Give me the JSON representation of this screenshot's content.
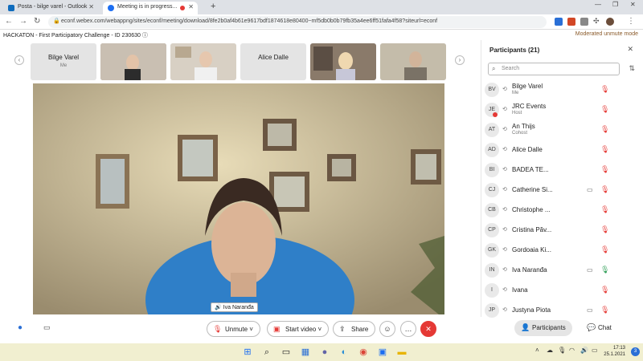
{
  "browser": {
    "tabs": [
      {
        "title": "Posta - bilge varel - Outlook",
        "active": false
      },
      {
        "title": "Meeting is in progress...",
        "active": true
      }
    ],
    "url": "econf.webex.com/webappng/sites/econf/meeting/download/8fe2b0af4b61e9617bdf1874618e80400~mf5db0b0b79fb35a4ee6ff51fafa4f58?siteurl=econf"
  },
  "meeting": {
    "title": "HACKATON - First Participatory Challenge - ID 230630",
    "moderated_unmute": "Moderated unmute mode"
  },
  "thumbnails": [
    {
      "name": "Bilge Varel",
      "sub": "Me",
      "type": "name"
    },
    {
      "name": "",
      "sub": "",
      "type": "video"
    },
    {
      "name": "",
      "sub": "",
      "type": "video"
    },
    {
      "name": "Alice Dalle",
      "sub": "",
      "type": "name"
    },
    {
      "name": "",
      "sub": "",
      "type": "video"
    },
    {
      "name": "",
      "sub": "",
      "type": "video"
    }
  ],
  "active_speaker": {
    "label": "Iva Naranđa"
  },
  "controls": {
    "unmute": "Unmute",
    "start_video": "Start video",
    "share": "Share"
  },
  "participants_panel": {
    "title": "Participants (21)",
    "search_placeholder": "Search",
    "rows": [
      {
        "initials": "BV",
        "name": "Bilge Varel",
        "role": "Me",
        "cam": false,
        "mic": "muted",
        "rec": false
      },
      {
        "initials": "JE",
        "name": "JRC Events",
        "role": "Host",
        "cam": false,
        "mic": "muted",
        "rec": true
      },
      {
        "initials": "AT",
        "name": "An Thijs",
        "role": "Cohost",
        "cam": false,
        "mic": "muted",
        "rec": false
      },
      {
        "initials": "AD",
        "name": "Alice Dalle",
        "role": "",
        "cam": false,
        "mic": "muted",
        "rec": false
      },
      {
        "initials": "BI",
        "name": "BADEA TE...",
        "role": "",
        "cam": false,
        "mic": "muted",
        "rec": false
      },
      {
        "initials": "CJ",
        "name": "Catherine Si...",
        "role": "",
        "cam": true,
        "mic": "muted",
        "rec": false
      },
      {
        "initials": "CB",
        "name": "Christophe ...",
        "role": "",
        "cam": false,
        "mic": "muted",
        "rec": false
      },
      {
        "initials": "CP",
        "name": "Cristina Păv...",
        "role": "",
        "cam": false,
        "mic": "muted",
        "rec": false
      },
      {
        "initials": "GK",
        "name": "Gordoaia Ki...",
        "role": "",
        "cam": false,
        "mic": "muted",
        "rec": false
      },
      {
        "initials": "IN",
        "name": "Iva Naranđa",
        "role": "",
        "cam": true,
        "mic": "on",
        "rec": false
      },
      {
        "initials": "I",
        "name": "Ivana",
        "role": "",
        "cam": false,
        "mic": "muted",
        "rec": false
      },
      {
        "initials": "JP",
        "name": "Justyna Piota",
        "role": "",
        "cam": true,
        "mic": "muted",
        "rec": false
      }
    ]
  },
  "panel_tabs": {
    "participants": "Participants",
    "chat": "Chat"
  },
  "taskbar": {
    "time": "17:13",
    "date": "25.1.2021",
    "notifications": "3"
  }
}
